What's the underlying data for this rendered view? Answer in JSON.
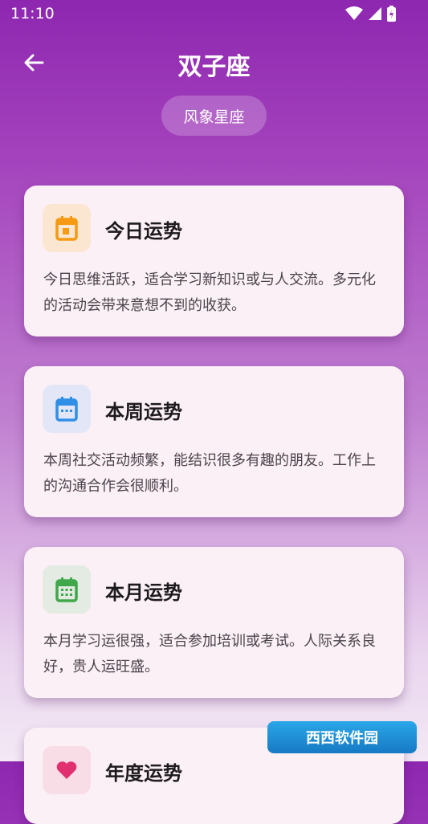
{
  "status_bar": {
    "time": "11:10"
  },
  "header": {
    "title": "双子座",
    "tag": "风象星座"
  },
  "cards": [
    {
      "title": "今日运势",
      "icon": "calendar-today-icon",
      "icon_color": "#f59a12",
      "icon_bg": "#fbe6d2",
      "text": "今日思维活跃，适合学习新知识或与人交流。多元化的活动会带来意想不到的收获。"
    },
    {
      "title": "本周运势",
      "icon": "calendar-week-icon",
      "icon_color": "#2f8fe6",
      "icon_bg": "#e2e6f6",
      "text": "本周社交活动频繁，能结识很多有趣的朋友。工作上的沟通合作会很顺利。"
    },
    {
      "title": "本月运势",
      "icon": "calendar-month-icon",
      "icon_color": "#3fa84a",
      "icon_bg": "#e4ebe2",
      "text": "本月学习运很强，适合参加培训或考试。人际关系良好，贵人运旺盛。"
    },
    {
      "title": "年度运势",
      "icon": "heart-icon",
      "icon_color": "#e03070",
      "icon_bg": "#f8dde6"
    }
  ],
  "watermark": {
    "text": "西西软件园"
  },
  "colors": {
    "header_gradient_top": "#8e27b0",
    "card_bg": "#fbf0f5"
  }
}
